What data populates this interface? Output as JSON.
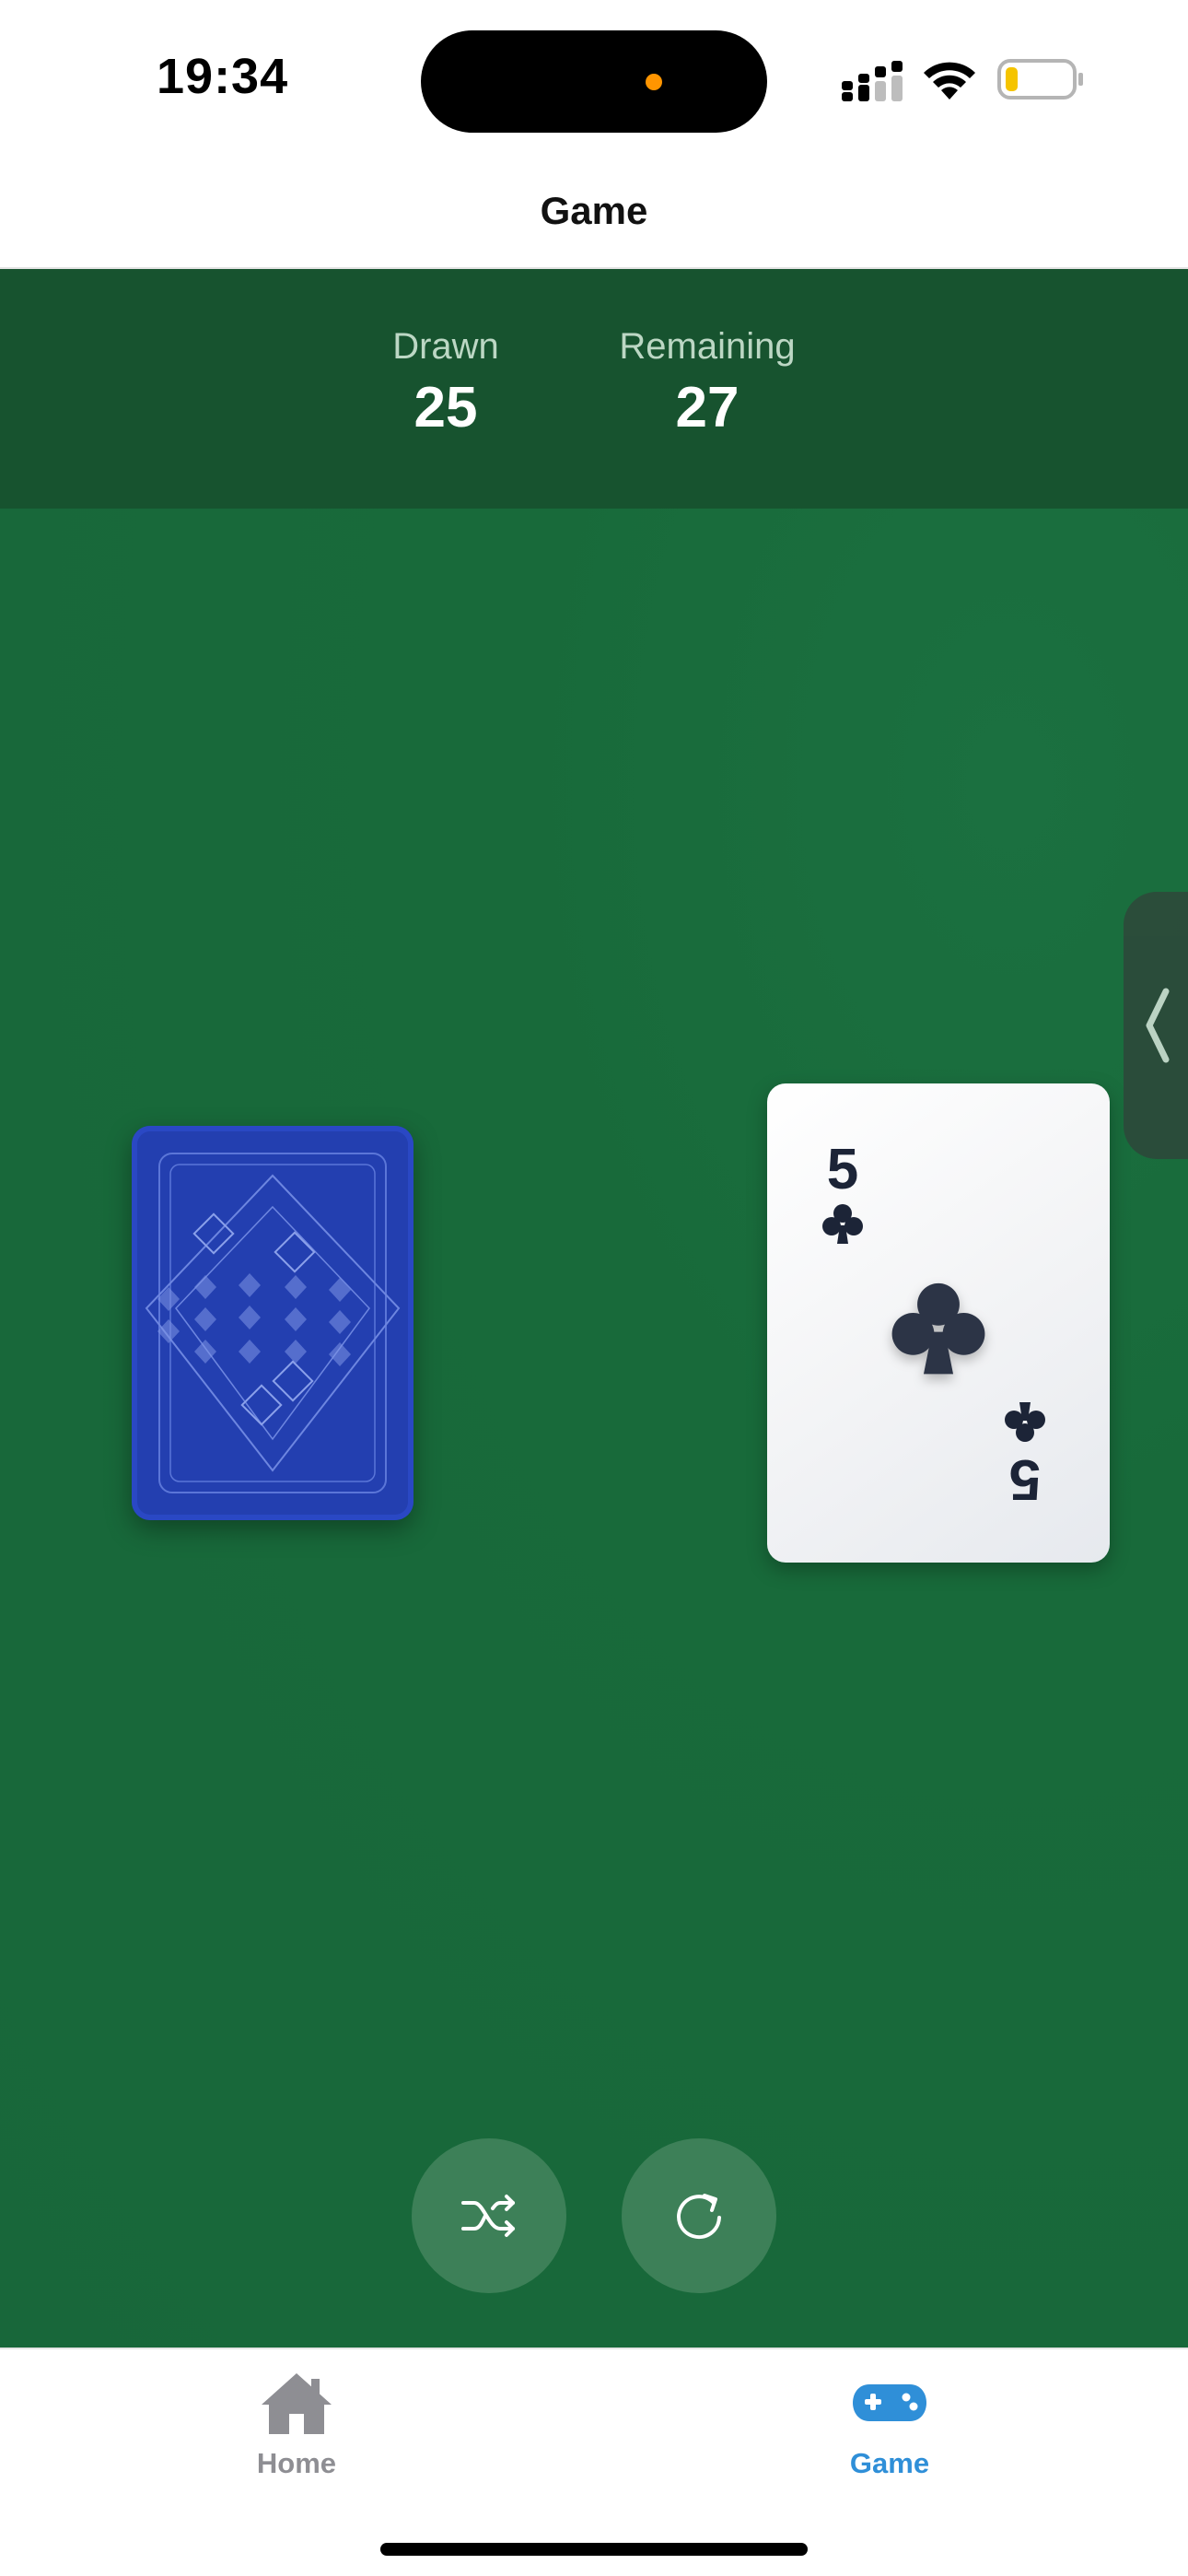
{
  "status_bar": {
    "time": "19:34"
  },
  "nav": {
    "title": "Game"
  },
  "stats": {
    "drawn_label": "Drawn",
    "drawn_value": "25",
    "remaining_label": "Remaining",
    "remaining_value": "27"
  },
  "current_card": {
    "rank": "5",
    "suit": "clubs"
  },
  "actions": {
    "shuffle_icon": "shuffle-icon",
    "restart_icon": "restart-icon"
  },
  "tab_bar": {
    "items": [
      {
        "label": "Home",
        "icon": "house-icon",
        "active": false
      },
      {
        "label": "Game",
        "icon": "gamepad-icon",
        "active": true
      }
    ]
  },
  "colors": {
    "table_green": "#18673a",
    "header_green": "#17532f",
    "card_back_blue": "#233fb0",
    "active_tab": "#2f8fd8",
    "inactive_tab": "#8e8e93"
  }
}
